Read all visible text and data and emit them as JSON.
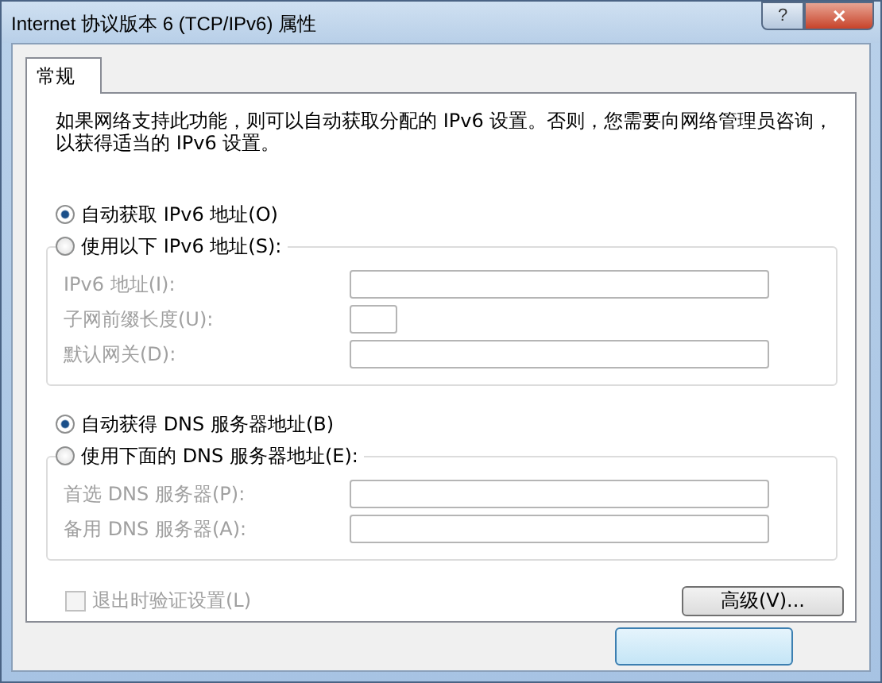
{
  "window": {
    "title": "Internet 协议版本 6 (TCP/IPv6) 属性",
    "help_button": "?",
    "close_button": "✕"
  },
  "tabs": [
    {
      "label": "常规",
      "selected": true
    }
  ],
  "description": "如果网络支持此功能，则可以自动获取分配的 IPv6 设置。否则，您需要向网络管理员咨询，以获得适当的 IPv6 设置。",
  "sections": [
    {
      "options": [
        {
          "label": "自动获取 IPv6 地址(O)",
          "selected": true
        },
        {
          "label": "使用以下 IPv6 地址(S):",
          "selected": false
        }
      ],
      "disabled": true,
      "fields": [
        {
          "label": "IPv6 地址(I):",
          "kind": "wide"
        },
        {
          "label": "子网前缀长度(U):",
          "kind": "short"
        },
        {
          "label": "默认网关(D):",
          "kind": "wide"
        }
      ]
    },
    {
      "options": [
        {
          "label": "自动获得 DNS 服务器地址(B)",
          "selected": true
        },
        {
          "label": "使用下面的 DNS 服务器地址(E):",
          "selected": false
        }
      ],
      "disabled": true,
      "fields": [
        {
          "label": "首选 DNS 服务器(P):",
          "kind": "wide"
        },
        {
          "label": "备用 DNS 服务器(A):",
          "kind": "wide"
        }
      ]
    }
  ],
  "validate_checkbox": {
    "label": "退出时验证设置(L)",
    "checked": false,
    "disabled": true
  },
  "advanced_button": "高级(V)..."
}
